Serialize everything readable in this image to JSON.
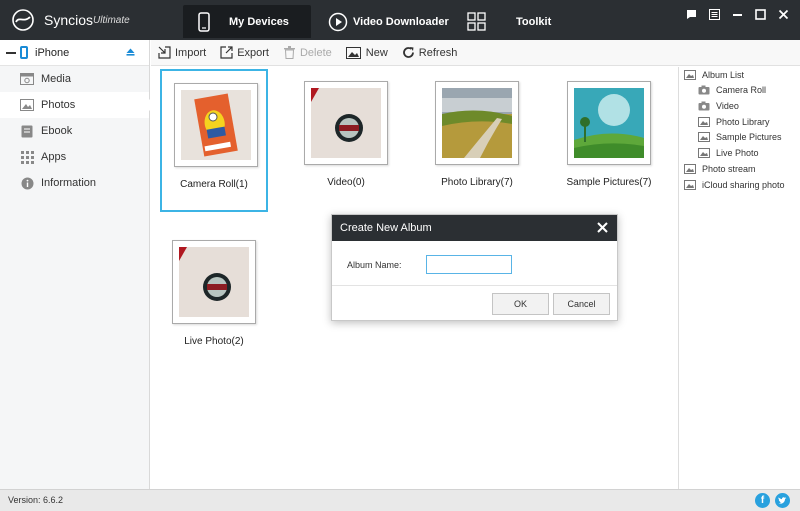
{
  "app": {
    "name": "Syncios",
    "edition": "Ultimate"
  },
  "nav": {
    "tabs": [
      {
        "label": "My Devices",
        "icon": "phone-icon",
        "active": true
      },
      {
        "label": "Video Downloader",
        "icon": "play-icon",
        "active": false
      },
      {
        "label": "Toolkit",
        "icon": "grid-icon",
        "active": false
      }
    ]
  },
  "window_controls": [
    "feedback-icon",
    "menu-icon",
    "minimize-icon",
    "maximize-icon",
    "close-icon"
  ],
  "sidebar": {
    "device": "iPhone",
    "items": [
      {
        "label": "Media",
        "icon": "media-icon"
      },
      {
        "label": "Photos",
        "icon": "photos-icon",
        "active": true
      },
      {
        "label": "Ebook",
        "icon": "ebook-icon"
      },
      {
        "label": "Apps",
        "icon": "apps-icon"
      },
      {
        "label": "Information",
        "icon": "information-icon"
      }
    ]
  },
  "toolbar": {
    "import": "Import",
    "export": "Export",
    "delete": "Delete",
    "new": "New",
    "refresh": "Refresh"
  },
  "albums": [
    {
      "label": "Camera Roll(1)",
      "selected": true
    },
    {
      "label": "Video(0)"
    },
    {
      "label": "Photo Library(7)"
    },
    {
      "label": "Sample Pictures(7)"
    },
    {
      "label": "Live Photo(2)"
    }
  ],
  "album_tree": {
    "root": "Album List",
    "children": [
      "Camera Roll",
      "Video",
      "Photo Library",
      "Sample Pictures",
      "Live Photo"
    ],
    "photo_stream": "Photo stream",
    "icloud": "iCloud sharing photo"
  },
  "dialog": {
    "title": "Create New Album",
    "label": "Album Name:",
    "value": "",
    "ok": "OK",
    "cancel": "Cancel"
  },
  "status": {
    "version": "Version: 6.6.2"
  },
  "colors": {
    "titlebar": "#2b2f33",
    "accent": "#3cb4e5",
    "facebook": "#29a1de",
    "twitter": "#29a1de"
  }
}
